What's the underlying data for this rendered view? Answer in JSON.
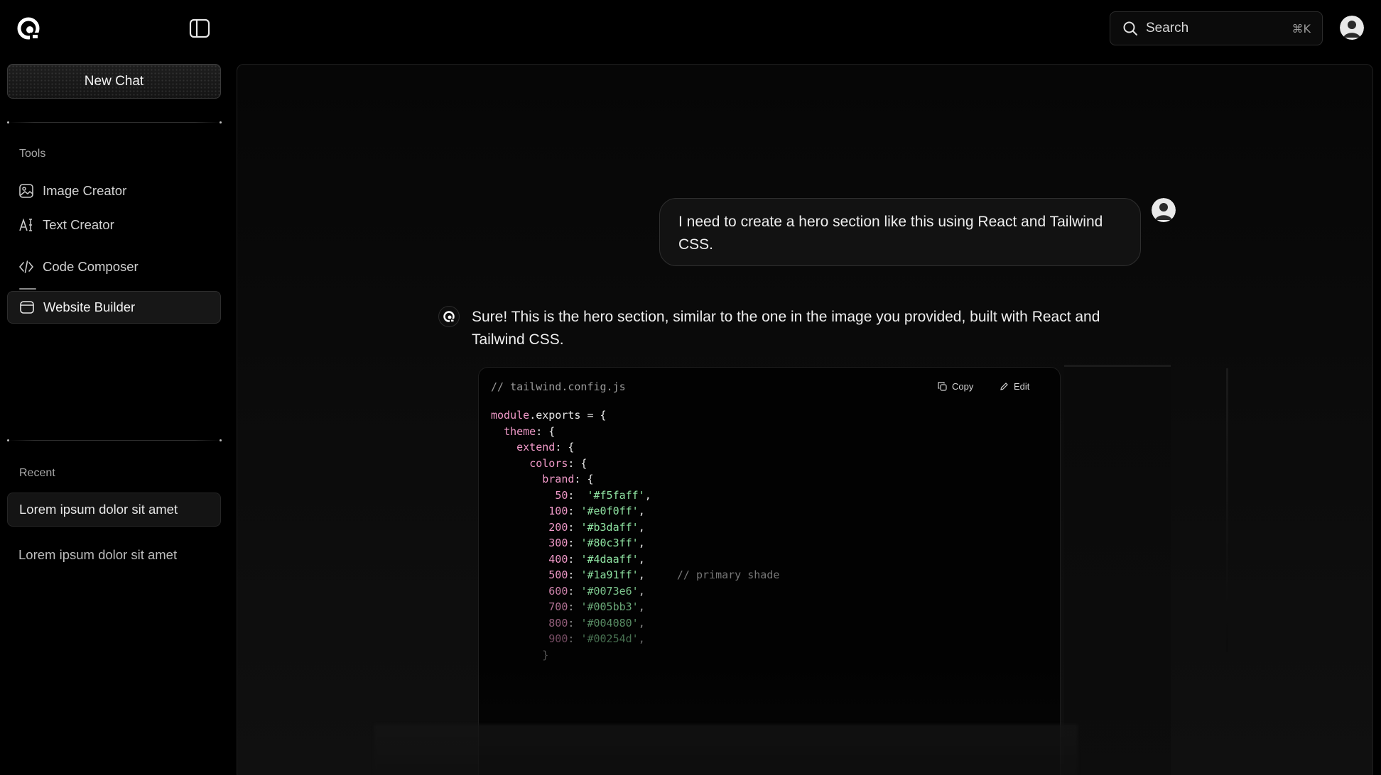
{
  "app": {
    "logo_icon": "spiral-logo-icon",
    "sidebar_toggle_icon": "sidebar-panel-icon"
  },
  "search": {
    "label": "Search",
    "shortcut": "⌘K",
    "icon": "search-icon"
  },
  "sidebar": {
    "new_chat_label": "New Chat",
    "tools_label": "Tools",
    "tools": [
      {
        "label": "Image Creator",
        "icon": "image-icon"
      },
      {
        "label": "Text Creator",
        "icon": "text-cursor-icon"
      },
      {
        "label": "Code Composer",
        "icon": "code-icon"
      },
      {
        "label": "Website Builder",
        "icon": "browser-window-icon",
        "active": true
      }
    ],
    "recent_label": "Recent",
    "recent": [
      {
        "label": "Lorem ipsum dolor sit amet",
        "active": true
      },
      {
        "label": "Lorem ipsum dolor sit amet"
      }
    ]
  },
  "chat": {
    "user_message": "I need to create a hero section like this using React and Tailwind CSS.",
    "bot_message": "Sure! This is the hero section, similar to the one in the image you provided, built with React and Tailwind CSS.",
    "code": {
      "filename": "// tailwind.config.js",
      "copy_label": "Copy",
      "edit_label": "Edit",
      "line1_kw": "module",
      "line1_rest": ".exports = {",
      "theme": "theme",
      "extend": "extend",
      "colors": "colors",
      "brand": "brand",
      "shades": [
        {
          "key": "50",
          "value": "'#f5faff'"
        },
        {
          "key": "100",
          "value": "'#e0f0ff'"
        },
        {
          "key": "200",
          "value": "'#b3daff'"
        },
        {
          "key": "300",
          "value": "'#80c3ff'"
        },
        {
          "key": "400",
          "value": "'#4daaff'"
        },
        {
          "key": "500",
          "value": "'#1a91ff'",
          "comment": "// primary shade"
        },
        {
          "key": "600",
          "value": "'#0073e6'"
        },
        {
          "key": "700",
          "value": "'#005bb3'"
        },
        {
          "key": "800",
          "value": "'#004080'"
        },
        {
          "key": "900",
          "value": "'#00254d'"
        }
      ]
    }
  },
  "colors": {
    "background": "#000000",
    "code_keyword": "#f19ac9",
    "code_string": "#8fe3a2"
  }
}
